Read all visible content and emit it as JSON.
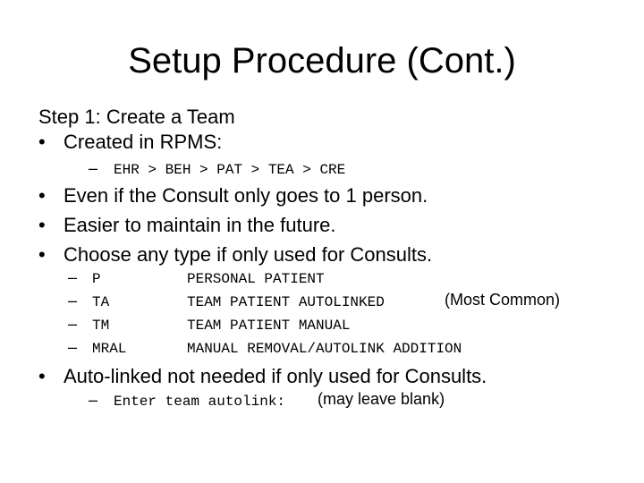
{
  "slide": {
    "title": "Setup Procedure (Cont.)",
    "step_heading": "Step 1: Create a Team",
    "bullet_glyph": "•",
    "dash_glyph": "–",
    "bullets_top": [
      {
        "text": "Created in RPMS:"
      }
    ],
    "rpms_path": "EHR > BEH > PAT > TEA > CRE",
    "bullets_mid": [
      {
        "text": "Even if the Consult only goes to 1 person."
      },
      {
        "text": "Easier to maintain in the future."
      },
      {
        "text": "Choose any type if only used for Consults."
      }
    ],
    "team_types": [
      {
        "code": "P",
        "description": "PERSONAL PATIENT",
        "note": ""
      },
      {
        "code": "TA",
        "description": "TEAM PATIENT AUTOLINKED",
        "note": "(Most Common)"
      },
      {
        "code": "TM",
        "description": "TEAM PATIENT MANUAL",
        "note": ""
      },
      {
        "code": "MRAL",
        "description": "MANUAL REMOVAL/AUTOLINK ADDITION",
        "note": ""
      }
    ],
    "bullets_bottom": [
      {
        "text": "Auto-linked not needed if only used for Consults."
      }
    ],
    "autolink_prompt": "Enter team autolink:",
    "autolink_note": "(may leave blank)"
  }
}
